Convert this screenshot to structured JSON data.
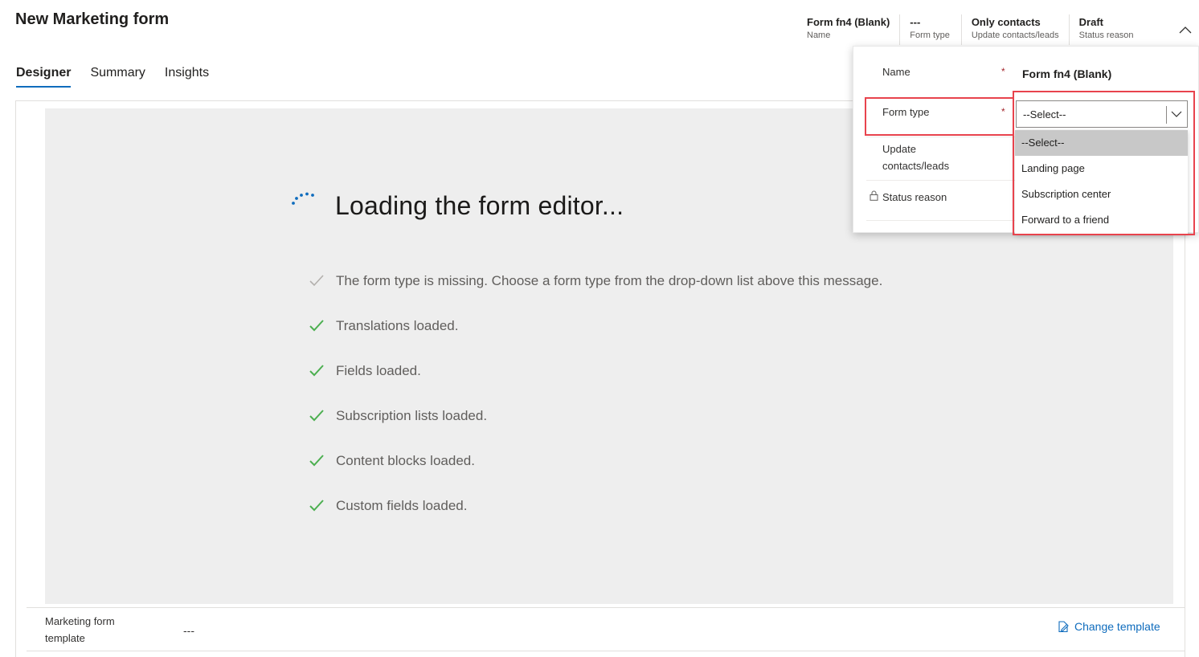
{
  "page": {
    "title": "New Marketing form"
  },
  "header_fields": [
    {
      "value": "Form fn4 (Blank)",
      "label": "Name"
    },
    {
      "value": "---",
      "label": "Form type"
    },
    {
      "value": "Only contacts",
      "label": "Update contacts/leads"
    },
    {
      "value": "Draft",
      "label": "Status reason"
    }
  ],
  "tabs": [
    {
      "label": "Designer",
      "active": true
    },
    {
      "label": "Summary",
      "active": false
    },
    {
      "label": "Insights",
      "active": false
    }
  ],
  "loading": {
    "title": "Loading the form editor...",
    "items": [
      {
        "text": "The form type is missing. Choose a form type from the drop-down list above this message.",
        "status": "pending"
      },
      {
        "text": "Translations loaded.",
        "status": "done"
      },
      {
        "text": "Fields loaded.",
        "status": "done"
      },
      {
        "text": "Subscription lists loaded.",
        "status": "done"
      },
      {
        "text": "Content blocks loaded.",
        "status": "done"
      },
      {
        "text": "Custom fields loaded.",
        "status": "done"
      }
    ]
  },
  "template_row": {
    "label": "Marketing form template",
    "value": "---",
    "change_label": "Change template"
  },
  "flyout": {
    "name_label": "Name",
    "name_value": "Form fn4 (Blank)",
    "form_type_label": "Form type",
    "update_label": "Update contacts/leads",
    "status_label": "Status reason",
    "required_mark": "*",
    "select_value": "--Select--",
    "options": [
      "--Select--",
      "Landing page",
      "Subscription center",
      "Forward to a friend"
    ],
    "selected_option": 0
  },
  "colors": {
    "accent": "#0f6cbd",
    "check_done": "#4caf50",
    "check_pending": "#b3b0ad",
    "highlight": "#e8434d",
    "panel_bg": "#eeeeee",
    "required": "#a4262c"
  },
  "icons": {
    "spinner": "loading-spinner-icon",
    "check": "checkmark-icon",
    "lock": "lock-icon",
    "edit": "edit-icon",
    "chevron_up": "chevron-up-icon",
    "chevron_down": "chevron-down-icon"
  }
}
